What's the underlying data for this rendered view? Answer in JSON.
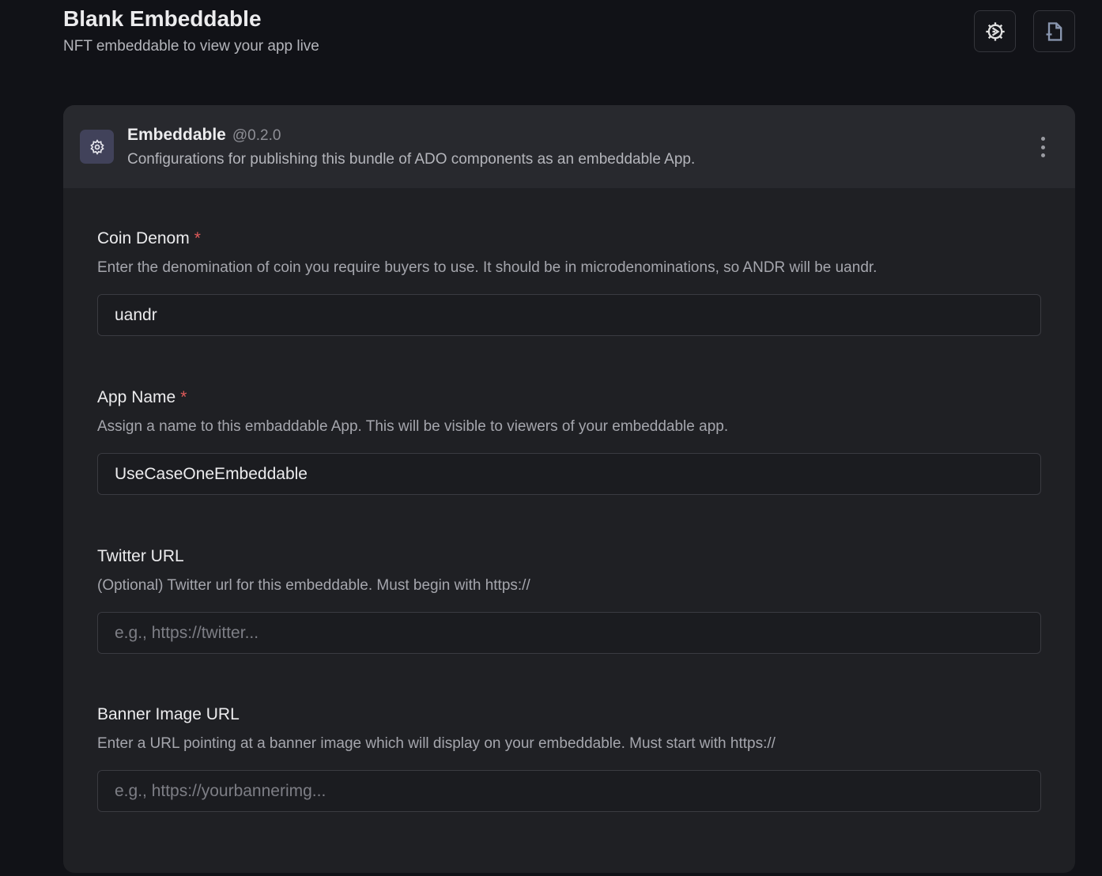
{
  "header": {
    "title": "Blank Embeddable",
    "subtitle": "NFT embeddable to view your app live"
  },
  "toolbar": {
    "settings_icon": "gear-icon",
    "add_file_icon": "file-plus-icon"
  },
  "card": {
    "name": "Embeddable",
    "version": "@0.2.0",
    "description": "Configurations for publishing this bundle of ADO components as an embeddable App."
  },
  "fields": [
    {
      "label": "Coin Denom",
      "required": "*",
      "description": "Enter the denomination of coin you require buyers to use. It should be in microdenominations, so ANDR will be uandr.",
      "value": "uandr"
    },
    {
      "label": "App Name",
      "required": "*",
      "description": "Assign a name to this embaddable App. This will be visible to viewers of your embeddable app.",
      "value": "UseCaseOneEmbeddable"
    },
    {
      "label": "Twitter URL",
      "description": "(Optional) Twitter url for this embeddable. Must begin with https://",
      "placeholder": "e.g., https://twitter..."
    },
    {
      "label": "Banner Image URL",
      "description": "Enter a URL pointing at a banner image which will display on your embeddable. Must start with https://",
      "placeholder": "e.g., https://yourbannerimg..."
    }
  ]
}
